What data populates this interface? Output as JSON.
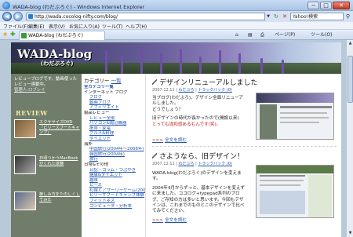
{
  "window": {
    "title": "WADA-blog (わだぶろぐ) - Windows Internet Explorer",
    "min_label": "─",
    "max_label": "□",
    "close_label": "✕"
  },
  "address": {
    "url": "http://wada.cocolog-nifty.com/blog/",
    "search_placeholder": "Yahoo!検索"
  },
  "menu": [
    "ファイル(F)",
    "編集(E)",
    "表示(V)",
    "お気に入り(A)",
    "ツール(T)",
    "ヘルプ(H)"
  ],
  "tab": {
    "label": "WADA-blog (わだぶろぐ)"
  },
  "commands": {
    "page": "ページ(P)",
    "tools": "ツール(O)"
  },
  "site": {
    "logo": "WADA-blog",
    "logo_sub": "(わだぶろぐ)",
    "intro": "レビューブログです。動画使ったレビュー連載中。",
    "intro_link": "管理人:ロブレイ",
    "review_title": "REVIEW",
    "reviews": [
      {
        "text": "エクササイズDVD「ビリーズブートキャンプ」"
      },
      {
        "text": "日頃つかうMacBookがくれた体験"
      },
      {
        "text": "楽しみ方をたのしくしてみた"
      }
    ],
    "categories": {
      "head": "カテゴリー",
      "more": "一覧",
      "items": [
        {
          "t": "全カテゴリー覧",
          "k": "top"
        },
        {
          "t": "インターネット ブログ",
          "k": "sec"
        },
        {
          "t": "ブログ",
          "k": "sub"
        },
        {
          "t": "動画ブログ",
          "k": "sub"
        },
        {
          "t": "アフィリエイト",
          "k": "sub"
        },
        {
          "t": "製品レビュー",
          "k": "sec"
        },
        {
          "t": "レビュー全般",
          "k": "sub"
        },
        {
          "t": "パソコン&周辺機器",
          "k": "sub"
        },
        {
          "t": "携帯・家電",
          "k": "sub"
        },
        {
          "t": "グルメ&料理",
          "k": "sub"
        },
        {
          "t": "ダイエット",
          "k": "sub"
        },
        {
          "t": "海外",
          "k": "sec"
        },
        {
          "t": "中国旅行(2004年～2006年)",
          "k": "sub"
        },
        {
          "t": "韓国旅行(2004年)",
          "k": "sub"
        },
        {
          "t": "旅行",
          "k": "sub"
        },
        {
          "t": "日常&その他",
          "k": "sec"
        },
        {
          "t": "日記・コラム・つぶやき",
          "k": "sub"
        },
        {
          "t": "健康&ダイエット",
          "k": "sub"
        },
        {
          "t": "趣味",
          "k": "sub"
        },
        {
          "t": "ピース",
          "k": "sub"
        },
        {
          "t": "札幌とアサーリーゲーム(2007年)",
          "k": "sub"
        },
        {
          "t": "ビリーザブートキャンプ体験",
          "k": "sub"
        },
        {
          "t": "フィットネス",
          "k": "sub"
        },
        {
          "t": "コンピュータ・分析本",
          "k": "sub"
        }
      ]
    },
    "posts": [
      {
        "title": "デザインリニューアルしました",
        "meta_date": "2007.12.11",
        "meta_author": "わだぶろ",
        "meta_trackback": "トラックバック (0)",
        "body1": "当ブログ(わだぶろ)、デザイン全面リニューアルしました。",
        "body2": "どうでしょう？",
        "body3": "旧デザインの時代が長かったので(開設以来)",
        "body4": "とっても違和感あるもんです(笑)。",
        "more": "全文を読む"
      },
      {
        "title": "さようなら、旧デザイン！",
        "meta_date": "2007.12.11",
        "meta_author": "わだぶろ",
        "meta_trackback": "トラックバック (0)",
        "body1": "WADA-blog(わだぶろぐ)のデザインを変えます。",
        "body2": "2004年4月からずっと、基本デザインを変えずに来ました。ココログ+typepad系列のブログ、ご存知の方は多いと思います。今回もデザインは、これまでのものとこのデザインで比べてみてください。",
        "more": "全文を読む"
      }
    ]
  },
  "colors": {
    "accent": "#2255aa",
    "sidebar_bg": "#6f7d6a",
    "red": "#cc2222"
  }
}
